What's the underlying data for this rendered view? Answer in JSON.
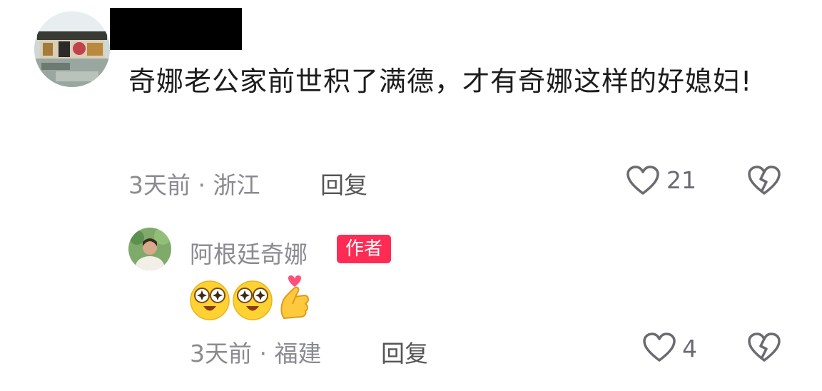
{
  "comment": {
    "text": "奇娜老公家前世积了满德，才有奇娜这样的好媳妇!",
    "time_location": "3天前 · 浙江",
    "reply_label": "回复",
    "like_count": "21"
  },
  "reply_comment": {
    "username": "阿根廷奇娜",
    "author_badge": "作者",
    "emojis": [
      "star-eyes-emoji",
      "star-eyes-emoji",
      "finger-heart-emoji"
    ],
    "time_location": "3天前 · 福建",
    "reply_label": "回复",
    "like_count": "4"
  },
  "colors": {
    "badge": "#fe2c55",
    "meta_text": "#8a8b91",
    "icon": "#6a6b70"
  }
}
